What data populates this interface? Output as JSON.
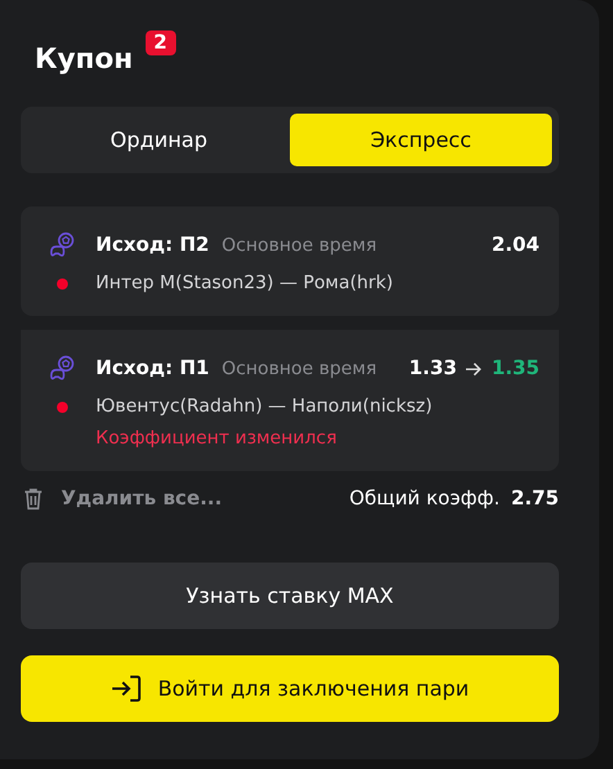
{
  "coupon": {
    "title": "Купон",
    "count": "2"
  },
  "tabs": [
    {
      "label": "Ординар",
      "selected": false
    },
    {
      "label": "Экспресс",
      "selected": true
    }
  ],
  "bets": [
    {
      "outcome": "Исход: П2",
      "period": "Основное время",
      "odds": "2.04",
      "match": "Интер М(Stason23) — Рома(hrk)",
      "live": true
    },
    {
      "outcome": "Исход: П1",
      "period": "Основное время",
      "previous_odds": "1.33",
      "odds": "1.35",
      "match": "Ювентус(Radahn) — Наполи(nicksz)",
      "live": true,
      "warning": "Коэффициент изменился"
    }
  ],
  "delete_all": "Удалить все...",
  "total": {
    "label": "Общий коэфф.",
    "value": "2.75"
  },
  "max_button": "Узнать ставку MAX",
  "login_button": "Войти для заключения пари"
}
